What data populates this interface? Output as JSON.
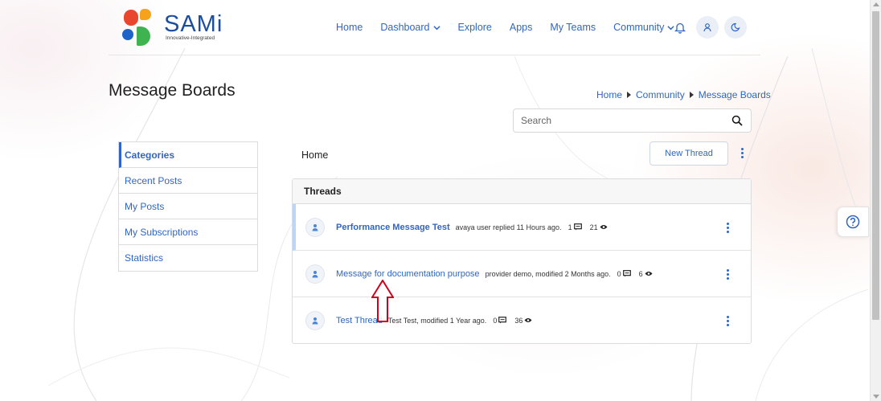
{
  "brand": {
    "name": "SAMi",
    "tagline": "Innovative-Integrated"
  },
  "nav": {
    "items": [
      {
        "label": "Home",
        "has_dropdown": false
      },
      {
        "label": "Dashboard",
        "has_dropdown": true
      },
      {
        "label": "Explore",
        "has_dropdown": false
      },
      {
        "label": "Apps",
        "has_dropdown": false
      },
      {
        "label": "My Teams",
        "has_dropdown": false
      },
      {
        "label": "Community",
        "has_dropdown": true
      }
    ],
    "icons": [
      "bell-icon",
      "user-icon",
      "moon-icon"
    ]
  },
  "page": {
    "title": "Message Boards"
  },
  "breadcrumb": [
    "Home",
    "Community",
    "Message Boards"
  ],
  "search": {
    "placeholder": "Search",
    "value": ""
  },
  "sidebar": {
    "items": [
      {
        "label": "Categories",
        "active": true
      },
      {
        "label": "Recent Posts",
        "active": false
      },
      {
        "label": "My Posts",
        "active": false
      },
      {
        "label": "My Subscriptions",
        "active": false
      },
      {
        "label": "Statistics",
        "active": false
      }
    ]
  },
  "main": {
    "location_label": "Home",
    "new_thread_label": "New Thread",
    "threads_header": "Threads",
    "threads": [
      {
        "title": "Performance Message Test",
        "meta": "avaya user replied 11 Hours ago.",
        "replies": "1",
        "views": "21",
        "highlighted": true
      },
      {
        "title": "Message for documentation purpose",
        "meta": "provider demo, modified 2 Months ago.",
        "replies": "0",
        "views": "6",
        "highlighted": false
      },
      {
        "title": "Test Thread",
        "meta": "Test Test, modified 1 Year ago.",
        "replies": "0",
        "views": "36",
        "highlighted": false
      }
    ]
  },
  "colors": {
    "accent": "#2f66c4",
    "annotation_arrow": "#d0021b",
    "highlight_bar": "#bcd6f5"
  }
}
